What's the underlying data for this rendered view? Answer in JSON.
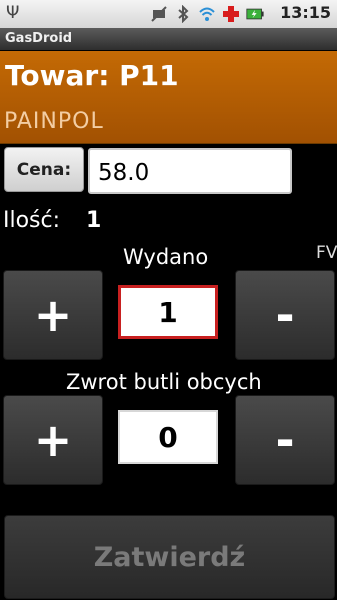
{
  "status_bar": {
    "time": "13:15",
    "icons": [
      "usb-icon",
      "no-sim-icon",
      "bluetooth-icon",
      "wifi-icon",
      "red-cross-icon",
      "battery-charging-icon"
    ]
  },
  "app": {
    "title": "GasDroid"
  },
  "header": {
    "title": "Towar: P11",
    "subtitle": "PAINPOL"
  },
  "price": {
    "button_label": "Cena:",
    "value": "58.0"
  },
  "quantity": {
    "label": "Ilość:",
    "value": "1"
  },
  "issued": {
    "title": "Wydano",
    "flag": "FV",
    "plus_label": "+",
    "minus_label": "-",
    "value": "1"
  },
  "returned": {
    "title": "Zwrot butli obcych",
    "plus_label": "+",
    "minus_label": "-",
    "value": "0"
  },
  "confirm": {
    "label": "Zatwierdź"
  },
  "colors": {
    "header_bg": "#b55d03",
    "subtitle": "#f3cda3",
    "focus_border": "#c82020",
    "disabled_text": "#7a7a7a"
  }
}
